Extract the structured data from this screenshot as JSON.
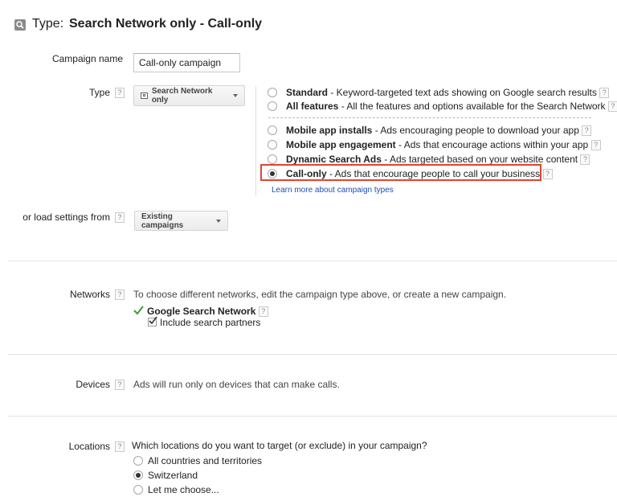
{
  "header": {
    "icon": "search-icon",
    "prefix": "Type:",
    "value": "Search Network only - Call-only"
  },
  "campaign_name": {
    "label": "Campaign name",
    "value": "Call-only campaign"
  },
  "type": {
    "label": "Type",
    "dropdown_label": "Search Network only",
    "options_top": [
      {
        "name": "Standard",
        "desc": " - Keyword-targeted text ads showing on Google search results",
        "selected": false
      },
      {
        "name": "All features",
        "desc": " - All the features and options available for the Search Network",
        "selected": false
      }
    ],
    "options_bottom": [
      {
        "name": "Mobile app installs",
        "desc": " - Ads encouraging people to download your app",
        "selected": false
      },
      {
        "name": "Mobile app engagement",
        "desc": " - Ads that encourage actions within your app",
        "selected": false
      },
      {
        "name": "Dynamic Search Ads",
        "desc": " - Ads targeted based on your website content",
        "selected": false
      },
      {
        "name": "Call-only",
        "desc": " - Ads that encourage people to call your business",
        "selected": true
      }
    ],
    "learn_more": "Learn more about campaign types",
    "highlight_color": "#e0452f"
  },
  "load_settings": {
    "label": "or load settings from",
    "dropdown_label": "Existing campaigns"
  },
  "networks": {
    "label": "Networks",
    "description": "To choose different networks, edit the campaign type above, or create a new campaign.",
    "network_name": "Google Search Network",
    "partners_label": "Include search partners",
    "check_color": "#3c9a3c"
  },
  "devices": {
    "label": "Devices",
    "description": "Ads will run only on devices that can make calls."
  },
  "locations": {
    "label": "Locations",
    "question": "Which locations do you want to target (or exclude) in your campaign?",
    "options": [
      {
        "label": "All countries and territories",
        "selected": false
      },
      {
        "label": "Switzerland",
        "selected": true
      },
      {
        "label": "Let me choose...",
        "selected": false
      }
    ]
  },
  "help_glyph": "?"
}
